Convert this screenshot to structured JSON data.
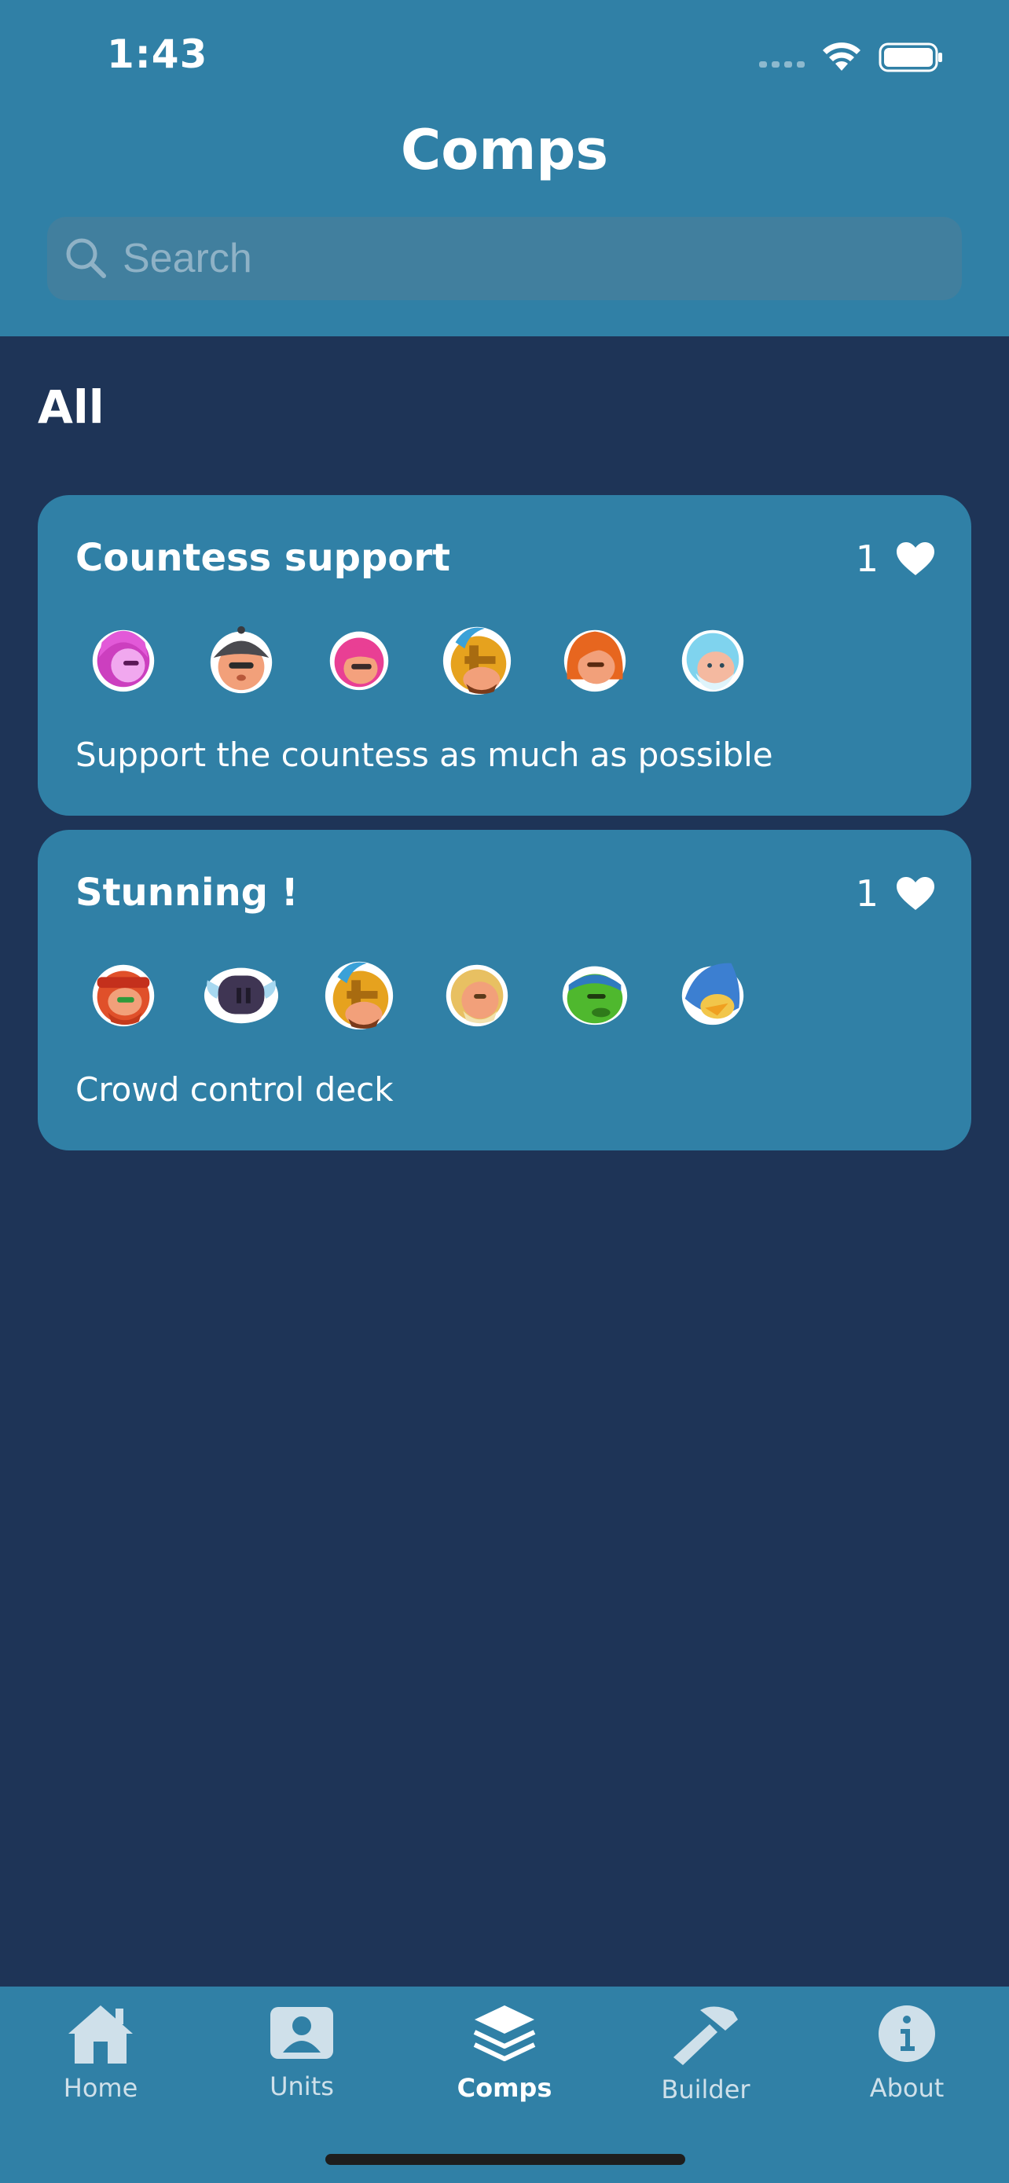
{
  "status_bar": {
    "time": "1:43"
  },
  "header": {
    "title": "Comps"
  },
  "search": {
    "placeholder": "Search"
  },
  "section": {
    "title": "All"
  },
  "comps": [
    {
      "title": "Countess support",
      "likes": "1",
      "description": "Support the countess as much as possible",
      "units": [
        "pink-hood",
        "helmet-soldier",
        "pink-hair",
        "gold-knight",
        "orange-hair",
        "ice-wizard"
      ]
    },
    {
      "title": "Stunning !",
      "likes": "1",
      "description": "Crowd control deck",
      "units": [
        "red-bandana",
        "dark-viking",
        "gold-knight",
        "blonde-monk",
        "green-goblin",
        "blue-bird"
      ]
    }
  ],
  "tabs": [
    {
      "label": "Home",
      "icon": "house-icon"
    },
    {
      "label": "Units",
      "icon": "person-card-icon"
    },
    {
      "label": "Comps",
      "icon": "layers-icon",
      "active": true
    },
    {
      "label": "Builder",
      "icon": "hammer-icon"
    },
    {
      "label": "About",
      "icon": "info-icon"
    }
  ],
  "colors": {
    "background": "#1e3457",
    "header": "#3080a6",
    "card": "#3080a6",
    "search_field": "#417f9e"
  }
}
